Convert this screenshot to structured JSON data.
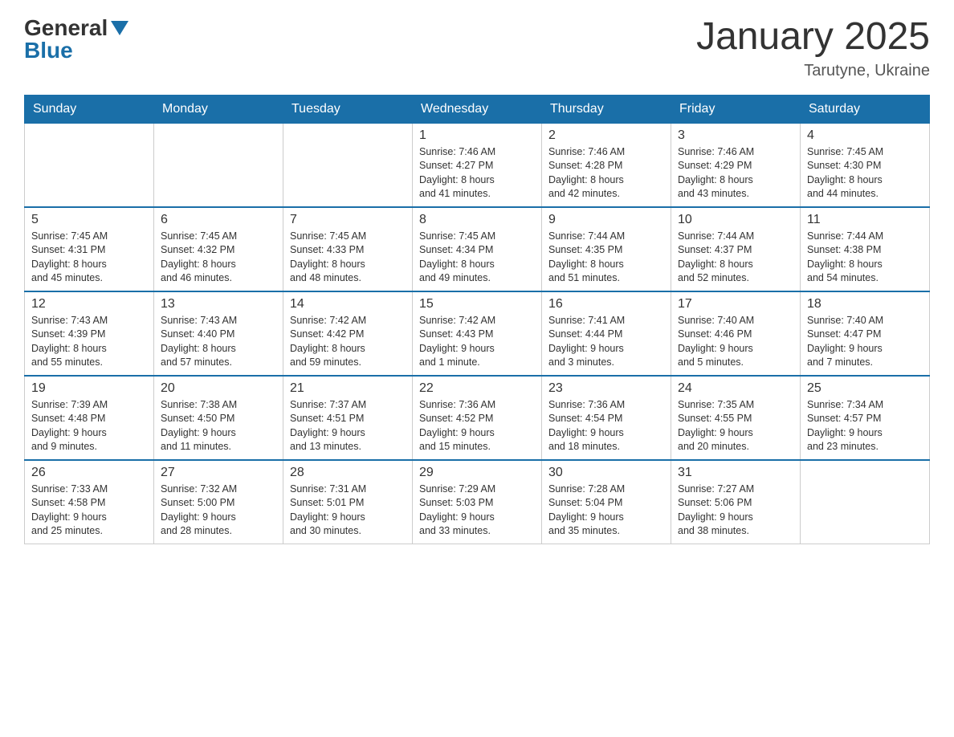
{
  "header": {
    "logo_general": "General",
    "logo_blue": "Blue",
    "month_title": "January 2025",
    "location": "Tarutyne, Ukraine"
  },
  "days_of_week": [
    "Sunday",
    "Monday",
    "Tuesday",
    "Wednesday",
    "Thursday",
    "Friday",
    "Saturday"
  ],
  "weeks": [
    {
      "days": [
        {
          "num": "",
          "info": ""
        },
        {
          "num": "",
          "info": ""
        },
        {
          "num": "",
          "info": ""
        },
        {
          "num": "1",
          "info": "Sunrise: 7:46 AM\nSunset: 4:27 PM\nDaylight: 8 hours\nand 41 minutes."
        },
        {
          "num": "2",
          "info": "Sunrise: 7:46 AM\nSunset: 4:28 PM\nDaylight: 8 hours\nand 42 minutes."
        },
        {
          "num": "3",
          "info": "Sunrise: 7:46 AM\nSunset: 4:29 PM\nDaylight: 8 hours\nand 43 minutes."
        },
        {
          "num": "4",
          "info": "Sunrise: 7:45 AM\nSunset: 4:30 PM\nDaylight: 8 hours\nand 44 minutes."
        }
      ]
    },
    {
      "days": [
        {
          "num": "5",
          "info": "Sunrise: 7:45 AM\nSunset: 4:31 PM\nDaylight: 8 hours\nand 45 minutes."
        },
        {
          "num": "6",
          "info": "Sunrise: 7:45 AM\nSunset: 4:32 PM\nDaylight: 8 hours\nand 46 minutes."
        },
        {
          "num": "7",
          "info": "Sunrise: 7:45 AM\nSunset: 4:33 PM\nDaylight: 8 hours\nand 48 minutes."
        },
        {
          "num": "8",
          "info": "Sunrise: 7:45 AM\nSunset: 4:34 PM\nDaylight: 8 hours\nand 49 minutes."
        },
        {
          "num": "9",
          "info": "Sunrise: 7:44 AM\nSunset: 4:35 PM\nDaylight: 8 hours\nand 51 minutes."
        },
        {
          "num": "10",
          "info": "Sunrise: 7:44 AM\nSunset: 4:37 PM\nDaylight: 8 hours\nand 52 minutes."
        },
        {
          "num": "11",
          "info": "Sunrise: 7:44 AM\nSunset: 4:38 PM\nDaylight: 8 hours\nand 54 minutes."
        }
      ]
    },
    {
      "days": [
        {
          "num": "12",
          "info": "Sunrise: 7:43 AM\nSunset: 4:39 PM\nDaylight: 8 hours\nand 55 minutes."
        },
        {
          "num": "13",
          "info": "Sunrise: 7:43 AM\nSunset: 4:40 PM\nDaylight: 8 hours\nand 57 minutes."
        },
        {
          "num": "14",
          "info": "Sunrise: 7:42 AM\nSunset: 4:42 PM\nDaylight: 8 hours\nand 59 minutes."
        },
        {
          "num": "15",
          "info": "Sunrise: 7:42 AM\nSunset: 4:43 PM\nDaylight: 9 hours\nand 1 minute."
        },
        {
          "num": "16",
          "info": "Sunrise: 7:41 AM\nSunset: 4:44 PM\nDaylight: 9 hours\nand 3 minutes."
        },
        {
          "num": "17",
          "info": "Sunrise: 7:40 AM\nSunset: 4:46 PM\nDaylight: 9 hours\nand 5 minutes."
        },
        {
          "num": "18",
          "info": "Sunrise: 7:40 AM\nSunset: 4:47 PM\nDaylight: 9 hours\nand 7 minutes."
        }
      ]
    },
    {
      "days": [
        {
          "num": "19",
          "info": "Sunrise: 7:39 AM\nSunset: 4:48 PM\nDaylight: 9 hours\nand 9 minutes."
        },
        {
          "num": "20",
          "info": "Sunrise: 7:38 AM\nSunset: 4:50 PM\nDaylight: 9 hours\nand 11 minutes."
        },
        {
          "num": "21",
          "info": "Sunrise: 7:37 AM\nSunset: 4:51 PM\nDaylight: 9 hours\nand 13 minutes."
        },
        {
          "num": "22",
          "info": "Sunrise: 7:36 AM\nSunset: 4:52 PM\nDaylight: 9 hours\nand 15 minutes."
        },
        {
          "num": "23",
          "info": "Sunrise: 7:36 AM\nSunset: 4:54 PM\nDaylight: 9 hours\nand 18 minutes."
        },
        {
          "num": "24",
          "info": "Sunrise: 7:35 AM\nSunset: 4:55 PM\nDaylight: 9 hours\nand 20 minutes."
        },
        {
          "num": "25",
          "info": "Sunrise: 7:34 AM\nSunset: 4:57 PM\nDaylight: 9 hours\nand 23 minutes."
        }
      ]
    },
    {
      "days": [
        {
          "num": "26",
          "info": "Sunrise: 7:33 AM\nSunset: 4:58 PM\nDaylight: 9 hours\nand 25 minutes."
        },
        {
          "num": "27",
          "info": "Sunrise: 7:32 AM\nSunset: 5:00 PM\nDaylight: 9 hours\nand 28 minutes."
        },
        {
          "num": "28",
          "info": "Sunrise: 7:31 AM\nSunset: 5:01 PM\nDaylight: 9 hours\nand 30 minutes."
        },
        {
          "num": "29",
          "info": "Sunrise: 7:29 AM\nSunset: 5:03 PM\nDaylight: 9 hours\nand 33 minutes."
        },
        {
          "num": "30",
          "info": "Sunrise: 7:28 AM\nSunset: 5:04 PM\nDaylight: 9 hours\nand 35 minutes."
        },
        {
          "num": "31",
          "info": "Sunrise: 7:27 AM\nSunset: 5:06 PM\nDaylight: 9 hours\nand 38 minutes."
        },
        {
          "num": "",
          "info": ""
        }
      ]
    }
  ]
}
